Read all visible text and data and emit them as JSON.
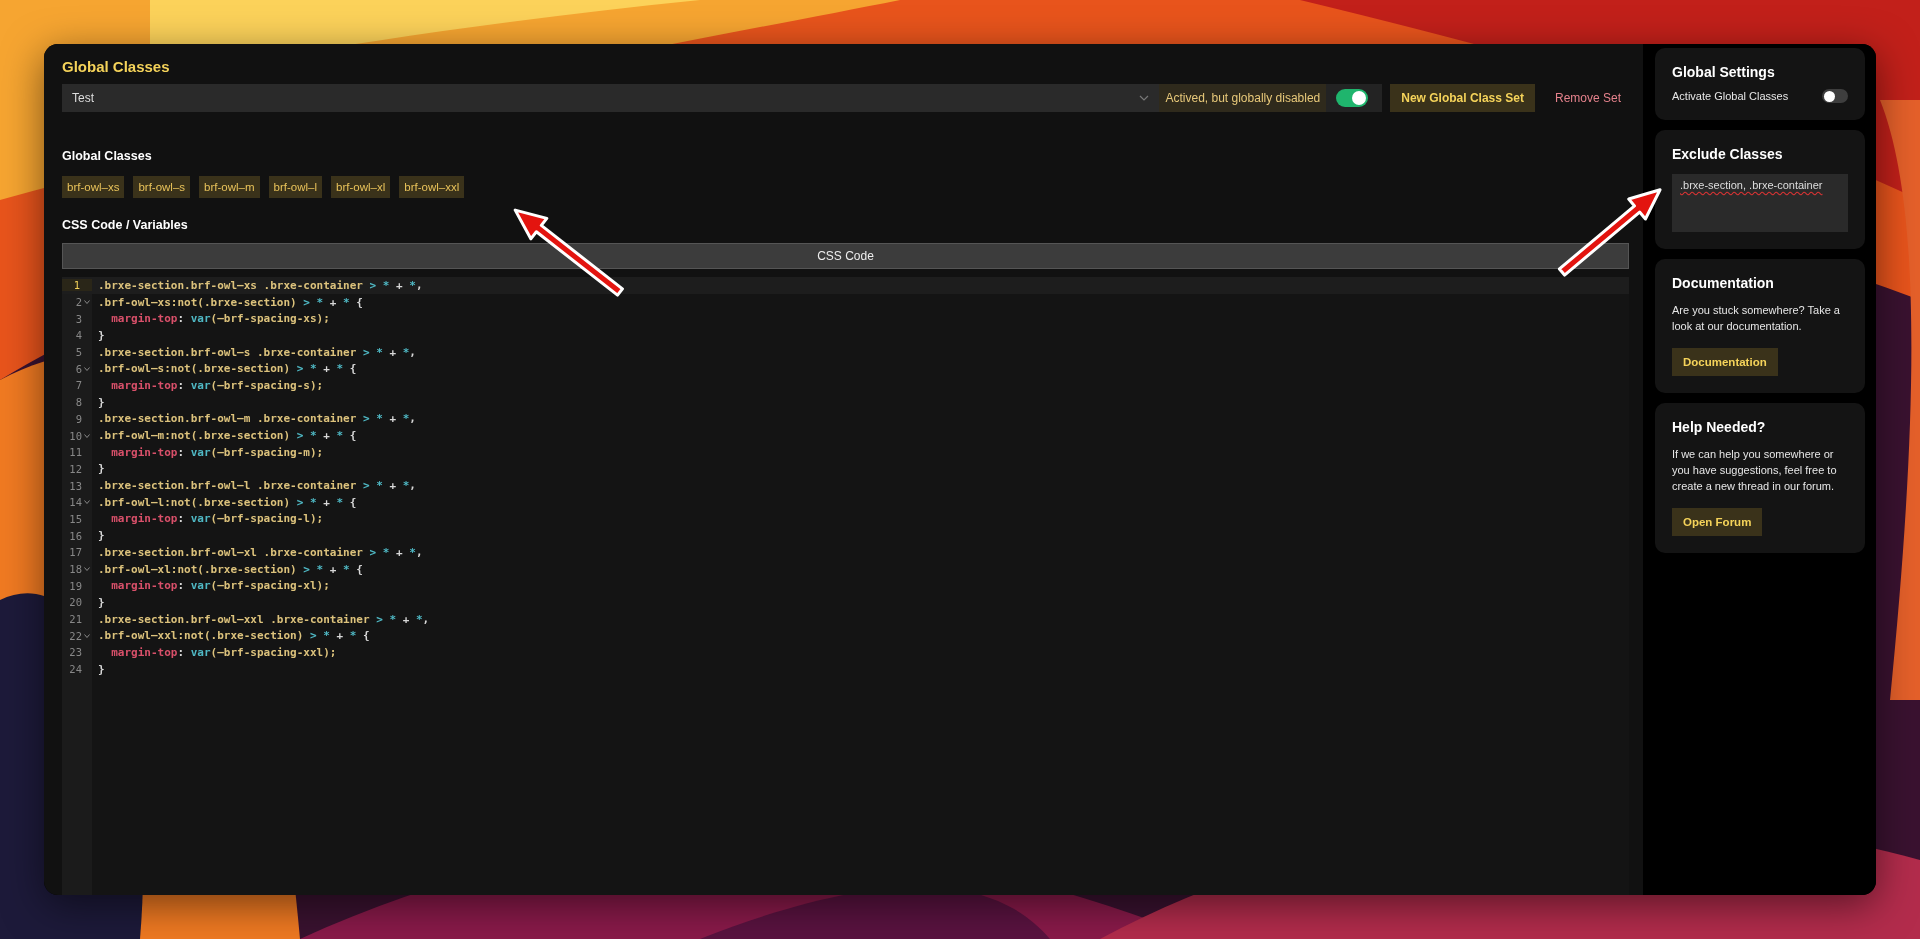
{
  "title": "Global Classes",
  "set_select": {
    "value": "Test"
  },
  "set_status": "Actived, but globally disabled",
  "set_toggle": {
    "on": true
  },
  "buttons": [
    {
      "label": "New Global Class Set",
      "kind": "primary"
    },
    {
      "label": "Remove Set",
      "kind": "danger"
    }
  ],
  "classes_section": {
    "heading": "Global Classes",
    "classes": [
      "brf-owl–xs",
      "brf-owl–s",
      "brf-owl–m",
      "brf-owl–l",
      "brf-owl–xl",
      "brf-owl–xxl"
    ]
  },
  "css_section": {
    "heading": "CSS Code / Variables",
    "tab": "CSS Code",
    "lines": [
      {
        "number": "1",
        "fold": false,
        "current": true,
        "tokens": [
          {
            "text": ".brxe-section.brf-owl—xs .brxe-container ",
            "kind": "selector"
          },
          {
            "text": "> * ",
            "kind": "operator"
          },
          {
            "text": "+ ",
            "kind": "plain"
          },
          {
            "text": "*",
            "kind": "operator"
          },
          {
            "text": ",",
            "kind": "plain"
          }
        ]
      },
      {
        "number": "2",
        "fold": true,
        "current": false,
        "tokens": [
          {
            "text": ".brf-owl—xs:not(.brxe-section) ",
            "kind": "selector"
          },
          {
            "text": "> * ",
            "kind": "operator"
          },
          {
            "text": "+ ",
            "kind": "plain"
          },
          {
            "text": "* ",
            "kind": "operator"
          },
          {
            "text": "{",
            "kind": "plain"
          }
        ]
      },
      {
        "number": "3",
        "fold": false,
        "current": false,
        "tokens": [
          {
            "text": "  margin-top",
            "kind": "property"
          },
          {
            "text": ": ",
            "kind": "plain"
          },
          {
            "text": "var",
            "kind": "function"
          },
          {
            "text": "(—brf-spacing-xs);",
            "kind": "argument"
          }
        ]
      },
      {
        "number": "4",
        "fold": false,
        "current": false,
        "tokens": [
          {
            "text": "}",
            "kind": "plain"
          }
        ]
      },
      {
        "number": "5",
        "fold": false,
        "current": false,
        "tokens": [
          {
            "text": ".brxe-section.brf-owl—s .brxe-container ",
            "kind": "selector"
          },
          {
            "text": "> * ",
            "kind": "operator"
          },
          {
            "text": "+ ",
            "kind": "plain"
          },
          {
            "text": "*",
            "kind": "operator"
          },
          {
            "text": ",",
            "kind": "plain"
          }
        ]
      },
      {
        "number": "6",
        "fold": true,
        "current": false,
        "tokens": [
          {
            "text": ".brf-owl—s:not(.brxe-section) ",
            "kind": "selector"
          },
          {
            "text": "> * ",
            "kind": "operator"
          },
          {
            "text": "+ ",
            "kind": "plain"
          },
          {
            "text": "* ",
            "kind": "operator"
          },
          {
            "text": "{",
            "kind": "plain"
          }
        ]
      },
      {
        "number": "7",
        "fold": false,
        "current": false,
        "tokens": [
          {
            "text": "  margin-top",
            "kind": "property"
          },
          {
            "text": ": ",
            "kind": "plain"
          },
          {
            "text": "var",
            "kind": "function"
          },
          {
            "text": "(—brf-spacing-s);",
            "kind": "argument"
          }
        ]
      },
      {
        "number": "8",
        "fold": false,
        "current": false,
        "tokens": [
          {
            "text": "}",
            "kind": "plain"
          }
        ]
      },
      {
        "number": "9",
        "fold": false,
        "current": false,
        "tokens": [
          {
            "text": ".brxe-section.brf-owl—m .brxe-container ",
            "kind": "selector"
          },
          {
            "text": "> * ",
            "kind": "operator"
          },
          {
            "text": "+ ",
            "kind": "plain"
          },
          {
            "text": "*",
            "kind": "operator"
          },
          {
            "text": ",",
            "kind": "plain"
          }
        ]
      },
      {
        "number": "10",
        "fold": true,
        "current": false,
        "tokens": [
          {
            "text": ".brf-owl—m:not(.brxe-section) ",
            "kind": "selector"
          },
          {
            "text": "> * ",
            "kind": "operator"
          },
          {
            "text": "+ ",
            "kind": "plain"
          },
          {
            "text": "* ",
            "kind": "operator"
          },
          {
            "text": "{",
            "kind": "plain"
          }
        ]
      },
      {
        "number": "11",
        "fold": false,
        "current": false,
        "tokens": [
          {
            "text": "  margin-top",
            "kind": "property"
          },
          {
            "text": ": ",
            "kind": "plain"
          },
          {
            "text": "var",
            "kind": "function"
          },
          {
            "text": "(—brf-spacing-m);",
            "kind": "argument"
          }
        ]
      },
      {
        "number": "12",
        "fold": false,
        "current": false,
        "tokens": [
          {
            "text": "}",
            "kind": "plain"
          }
        ]
      },
      {
        "number": "13",
        "fold": false,
        "current": false,
        "tokens": [
          {
            "text": ".brxe-section.brf-owl—l .brxe-container ",
            "kind": "selector"
          },
          {
            "text": "> * ",
            "kind": "operator"
          },
          {
            "text": "+ ",
            "kind": "plain"
          },
          {
            "text": "*",
            "kind": "operator"
          },
          {
            "text": ",",
            "kind": "plain"
          }
        ]
      },
      {
        "number": "14",
        "fold": true,
        "current": false,
        "tokens": [
          {
            "text": ".brf-owl—l:not(.brxe-section) ",
            "kind": "selector"
          },
          {
            "text": "> * ",
            "kind": "operator"
          },
          {
            "text": "+ ",
            "kind": "plain"
          },
          {
            "text": "* ",
            "kind": "operator"
          },
          {
            "text": "{",
            "kind": "plain"
          }
        ]
      },
      {
        "number": "15",
        "fold": false,
        "current": false,
        "tokens": [
          {
            "text": "  margin-top",
            "kind": "property"
          },
          {
            "text": ": ",
            "kind": "plain"
          },
          {
            "text": "var",
            "kind": "function"
          },
          {
            "text": "(—brf-spacing-l);",
            "kind": "argument"
          }
        ]
      },
      {
        "number": "16",
        "fold": false,
        "current": false,
        "tokens": [
          {
            "text": "}",
            "kind": "plain"
          }
        ]
      },
      {
        "number": "17",
        "fold": false,
        "current": false,
        "tokens": [
          {
            "text": ".brxe-section.brf-owl—xl .brxe-container ",
            "kind": "selector"
          },
          {
            "text": "> * ",
            "kind": "operator"
          },
          {
            "text": "+ ",
            "kind": "plain"
          },
          {
            "text": "*",
            "kind": "operator"
          },
          {
            "text": ",",
            "kind": "plain"
          }
        ]
      },
      {
        "number": "18",
        "fold": true,
        "current": false,
        "tokens": [
          {
            "text": ".brf-owl—xl:not(.brxe-section) ",
            "kind": "selector"
          },
          {
            "text": "> * ",
            "kind": "operator"
          },
          {
            "text": "+ ",
            "kind": "plain"
          },
          {
            "text": "* ",
            "kind": "operator"
          },
          {
            "text": "{",
            "kind": "plain"
          }
        ]
      },
      {
        "number": "19",
        "fold": false,
        "current": false,
        "tokens": [
          {
            "text": "  margin-top",
            "kind": "property"
          },
          {
            "text": ": ",
            "kind": "plain"
          },
          {
            "text": "var",
            "kind": "function"
          },
          {
            "text": "(—brf-spacing-xl);",
            "kind": "argument"
          }
        ]
      },
      {
        "number": "20",
        "fold": false,
        "current": false,
        "tokens": [
          {
            "text": "}",
            "kind": "plain"
          }
        ]
      },
      {
        "number": "21",
        "fold": false,
        "current": false,
        "tokens": [
          {
            "text": ".brxe-section.brf-owl—xxl .brxe-container ",
            "kind": "selector"
          },
          {
            "text": "> * ",
            "kind": "operator"
          },
          {
            "text": "+ ",
            "kind": "plain"
          },
          {
            "text": "*",
            "kind": "operator"
          },
          {
            "text": ",",
            "kind": "plain"
          }
        ]
      },
      {
        "number": "22",
        "fold": true,
        "current": false,
        "tokens": [
          {
            "text": ".brf-owl—xxl:not(.brxe-section) ",
            "kind": "selector"
          },
          {
            "text": "> * ",
            "kind": "operator"
          },
          {
            "text": "+ ",
            "kind": "plain"
          },
          {
            "text": "* ",
            "kind": "operator"
          },
          {
            "text": "{",
            "kind": "plain"
          }
        ]
      },
      {
        "number": "23",
        "fold": false,
        "current": false,
        "tokens": [
          {
            "text": "  margin-top",
            "kind": "property"
          },
          {
            "text": ": ",
            "kind": "plain"
          },
          {
            "text": "var",
            "kind": "function"
          },
          {
            "text": "(—brf-spacing-xxl);",
            "kind": "argument"
          }
        ]
      },
      {
        "number": "24",
        "fold": false,
        "current": false,
        "tokens": [
          {
            "text": "}",
            "kind": "plain"
          }
        ]
      }
    ]
  },
  "sidebar": {
    "global_settings": {
      "heading": "Global Settings",
      "label": "Activate Global Classes",
      "toggle": {
        "on": false
      }
    },
    "exclude_classes": {
      "heading": "Exclude Classes",
      "value": ".brxe-section, .brxe-container"
    },
    "documentation": {
      "heading": "Documentation",
      "text": "Are you stuck somewhere? Take a look at our documentation.",
      "button": "Documentation"
    },
    "help": {
      "heading": "Help Needed?",
      "text": "If we can help you somewhere or you have suggestions, feel free to create a new thread in our forum.",
      "button": "Open Forum"
    }
  }
}
